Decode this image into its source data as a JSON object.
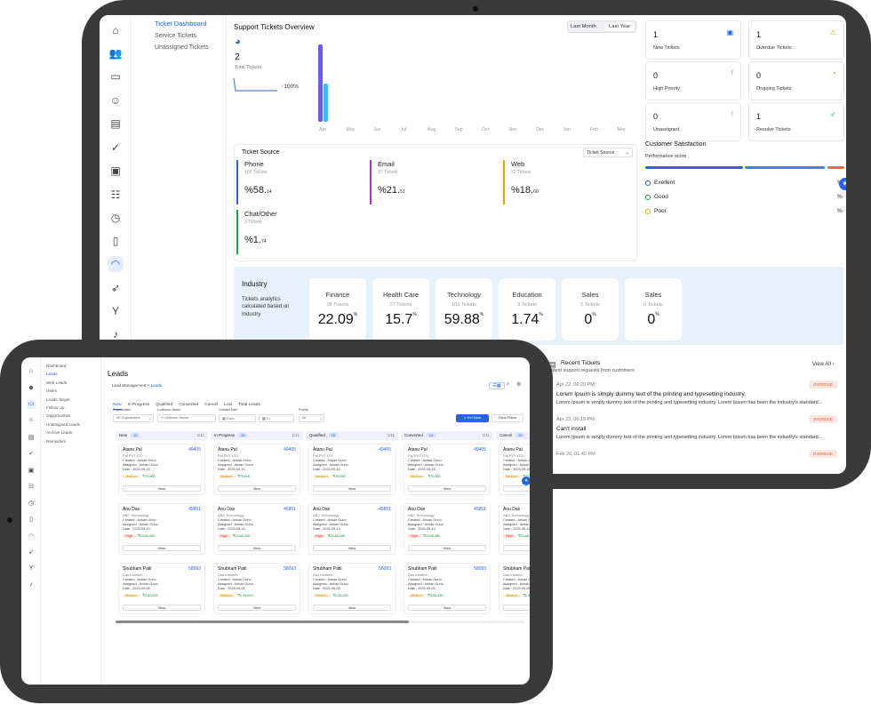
{
  "dashboard": {
    "subnav": [
      "Ticket Dashboard",
      "Service Tickets",
      "Unassigned Tickets"
    ],
    "overview": {
      "title": "Support Tickets Overview",
      "period_tabs": [
        "Last Month",
        "Last Year"
      ],
      "total": "2",
      "total_label": "Total Tickets",
      "pct": "100%",
      "months": [
        "Apr",
        "May",
        "Jun",
        "Jul",
        "Aug",
        "Sep",
        "Oct",
        "Nov",
        "Dec",
        "Jan",
        "Feb",
        "Mar"
      ]
    },
    "stats": [
      {
        "n": "1",
        "l": "New Tickets",
        "icon": "ticket-icon",
        "color": "#2563eb"
      },
      {
        "n": "1",
        "l": "Overdue Tickets",
        "icon": "clock-alert-icon",
        "color": "#e0a800"
      },
      {
        "n": "0",
        "l": "High Priority",
        "icon": "alert-icon",
        "color": "#e06020"
      },
      {
        "n": "0",
        "l": "Ongoing Tickets",
        "icon": "progress-icon",
        "color": "#e07b00"
      },
      {
        "n": "0",
        "l": "Unassigned",
        "icon": "warning-icon",
        "color": "#e07b00"
      },
      {
        "n": "1",
        "l": "Resolve Tickets",
        "icon": "check-icon",
        "color": "#1aa050"
      }
    ],
    "source": {
      "title": "Ticket Source",
      "select": "Ticket Source",
      "items": [
        {
          "name": "Phone",
          "sub": "100 Tickets",
          "val": "%58.",
          "dec": "14",
          "color": "#2563eb"
        },
        {
          "name": "Email",
          "sub": "37 Tickets",
          "val": "%21.",
          "dec": "51",
          "color": "#c026d3"
        },
        {
          "name": "Web",
          "sub": "32 Tickets",
          "val": "%18.",
          "dec": "60",
          "color": "#e0a800"
        },
        {
          "name": "Chat/Other",
          "sub": "3 Tickets",
          "val": "%1.",
          "dec": "74",
          "color": "#16a34a"
        }
      ]
    },
    "satisfaction": {
      "title": "Customer Satisfaction",
      "sub": "Performance score",
      "rows": [
        {
          "l": "Exellent",
          "v": "%",
          "color": "#2563eb"
        },
        {
          "l": "Good",
          "v": "%",
          "color": "#16a34a"
        },
        {
          "l": "Poor",
          "v": "%",
          "color": "#e0a800"
        }
      ]
    },
    "industry": {
      "title": "Industry",
      "desc": "Tickets analytics calculated based on Industry",
      "items": [
        {
          "n": "Finance",
          "s": "38 Tickets",
          "v": "22.09"
        },
        {
          "n": "Health Care",
          "s": "27 Tickets",
          "v": "15.7"
        },
        {
          "n": "Technology",
          "s": "103 Tickets",
          "v": "59.88"
        },
        {
          "n": "Education",
          "s": "3 Tickets",
          "v": "1.74"
        },
        {
          "n": "Sales",
          "s": "0 Tickets",
          "v": "0"
        },
        {
          "n": "Sales",
          "s": "0 Tickets",
          "v": "0"
        }
      ],
      "unit": "%"
    },
    "recent": {
      "title": "Recent Tickets",
      "sub": "Latest support requests from customers",
      "view_all": "View All",
      "items": [
        {
          "d": "Apr 22, 06:20 PM",
          "h": "Lorem Ipsum is simply dummy text of the printing and typesetting industry.",
          "b": "Lorem Ipsum is simply dummy text of the printing and typesetting industry. Lorem Ipsum has been the industry's standard...",
          "badge": "OVERDUE"
        },
        {
          "d": "Apr 22, 06:19 PM",
          "h": "Can't install",
          "b": "Lorem Ipsum is simply dummy text of the printing and typesetting industry. Lorem Ipsum has been the industry's standard...",
          "badge": "OVERDUE"
        },
        {
          "d": "Feb 20, 01:42 PM",
          "h": "",
          "b": "",
          "badge": "OVERDUE"
        }
      ]
    }
  },
  "leads": {
    "subnav": [
      "Dashboard",
      "Leads",
      "Web Leads",
      "Users",
      "Leads Target",
      "Follow Up",
      "Opportunities",
      "Unassigned Leads",
      "Archive Leads",
      "Reminders"
    ],
    "title": "Leads",
    "breadcrumb": [
      "Lead Management",
      ">",
      "Leads"
    ],
    "tabs": [
      "New",
      "In Progress",
      "Qualified",
      "Converted",
      "Cancel",
      "Lost",
      "Total Leads"
    ],
    "filters": {
      "org_label": "Organization",
      "org": "All Organization",
      "cust_label": "Customer Name",
      "cust": "Customer Name",
      "date_label": "Created Date",
      "from": "From",
      "to": "To",
      "prio_label": "Priority",
      "prio": "All",
      "get": "Get Data",
      "clear": "Clear Filters"
    },
    "columns": [
      {
        "name": "New",
        "count": "10",
        "page": "1/11"
      },
      {
        "name": "In Progress",
        "count": "10",
        "page": "1/11"
      },
      {
        "name": "Qualified",
        "count": "10",
        "page": "1/11"
      },
      {
        "name": "Converted",
        "count": "10",
        "page": "1/11"
      },
      {
        "name": "Cancel",
        "count": "10",
        "page": ""
      }
    ],
    "rows": [
      {
        "name": "Atanu Pal",
        "id": "49405",
        "co": "Pal PVT LTD",
        "created": "Created : Ankan Guho",
        "assigned": "Assigned : Ankan Guho",
        "date": "Date : 2025-05-16",
        "prio": "Medium",
        "amt": "₹70,000"
      },
      {
        "name": "Anu Das",
        "id": "45851",
        "co": "ABC Technology",
        "created": "Created : Ankan Guho",
        "assigned": "Assigned : Ankan Guho",
        "date": "Date : 2025-05-13",
        "prio": "High",
        "amt": "₹23,68,260"
      },
      {
        "name": "Shubham Patil",
        "id": "58093",
        "co": "Das Infotech",
        "created": "Created : Ankan Guho",
        "assigned": "Assigned : Ankan Guho",
        "date": "Date : 2025-05-05",
        "prio": "Medium",
        "amt": "₹2,53,620"
      }
    ],
    "view": "View"
  }
}
